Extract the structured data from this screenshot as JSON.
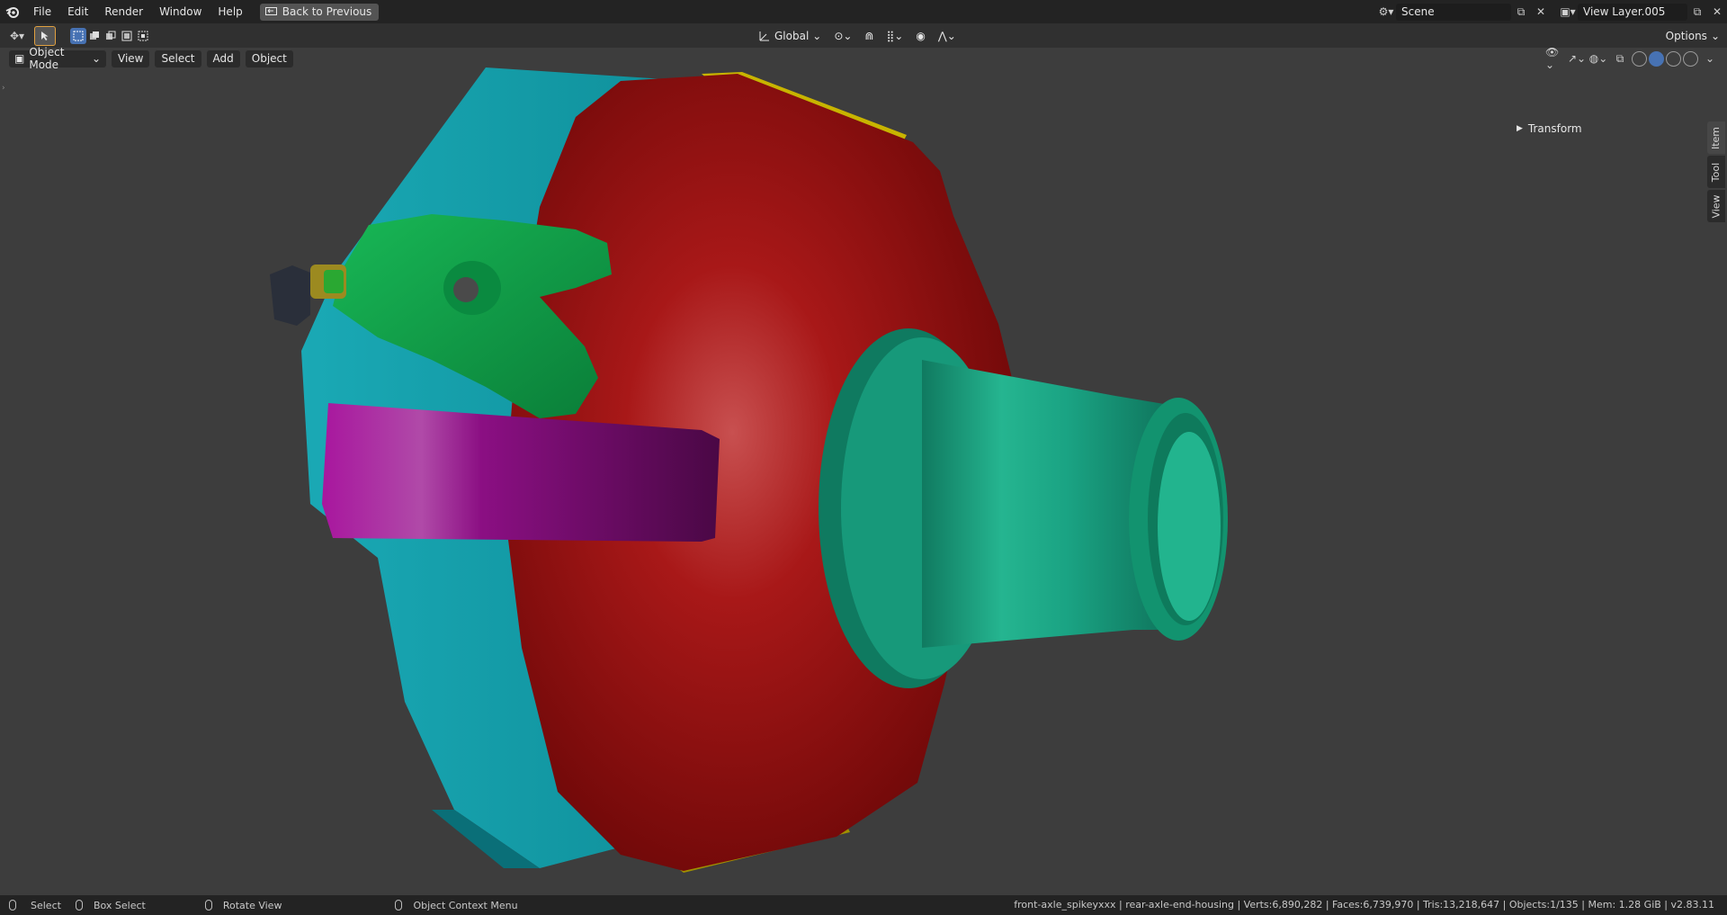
{
  "topbar": {
    "menus": [
      "File",
      "Edit",
      "Render",
      "Window",
      "Help"
    ],
    "back_button": "Back to Previous",
    "scene_name": "Scene",
    "view_layer": "View Layer.005"
  },
  "toolheader": {
    "orientation": "Global",
    "options": "Options"
  },
  "viewport_header": {
    "mode": "Object Mode",
    "menus": [
      "View",
      "Select",
      "Add",
      "Object"
    ]
  },
  "npanel": {
    "transform_label": "Transform",
    "tabs": [
      "Item",
      "Tool",
      "View"
    ]
  },
  "statusbar": {
    "select": "Select",
    "box_select": "Box Select",
    "rotate_view": "Rotate View",
    "context_menu": "Object Context Menu",
    "stats": "front-axle_spikeyxxx | rear-axle-end-housing | Verts:6,890,282 | Faces:6,739,970 | Tris:13,218,647 | Objects:1/135 | Mem: 1.28 GiB | v2.83.11"
  },
  "colors": {
    "housing_red": "#a51010",
    "cyan_plate": "#16a9b5",
    "teal_hub": "#18a585",
    "green_arm": "#0ea84c",
    "magenta_band": "#8a0f84",
    "yellow_rim": "#c8b400",
    "accent_blue": "#4772b3"
  }
}
